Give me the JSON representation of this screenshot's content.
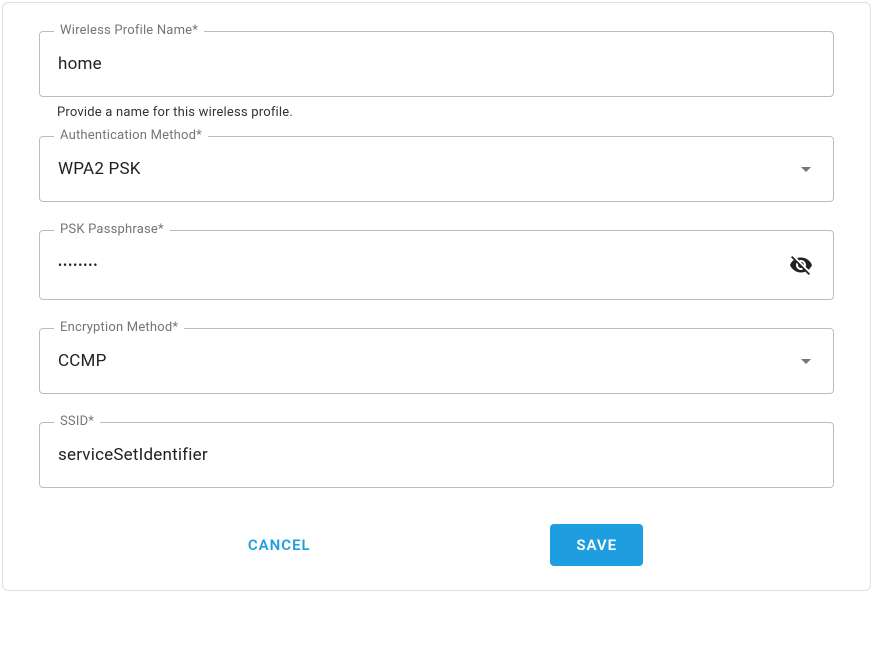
{
  "fields": {
    "profile_name": {
      "label": "Wireless Profile Name*",
      "value": "home",
      "helper": "Provide a name for this wireless profile."
    },
    "auth_method": {
      "label": "Authentication Method*",
      "value": "WPA2 PSK"
    },
    "psk": {
      "label": "PSK Passphrase*",
      "masked": "••••••••"
    },
    "encryption": {
      "label": "Encryption Method*",
      "value": "CCMP"
    },
    "ssid": {
      "label": "SSID*",
      "value": "serviceSetIdentifier"
    }
  },
  "buttons": {
    "cancel": "CANCEL",
    "save": "SAVE"
  }
}
